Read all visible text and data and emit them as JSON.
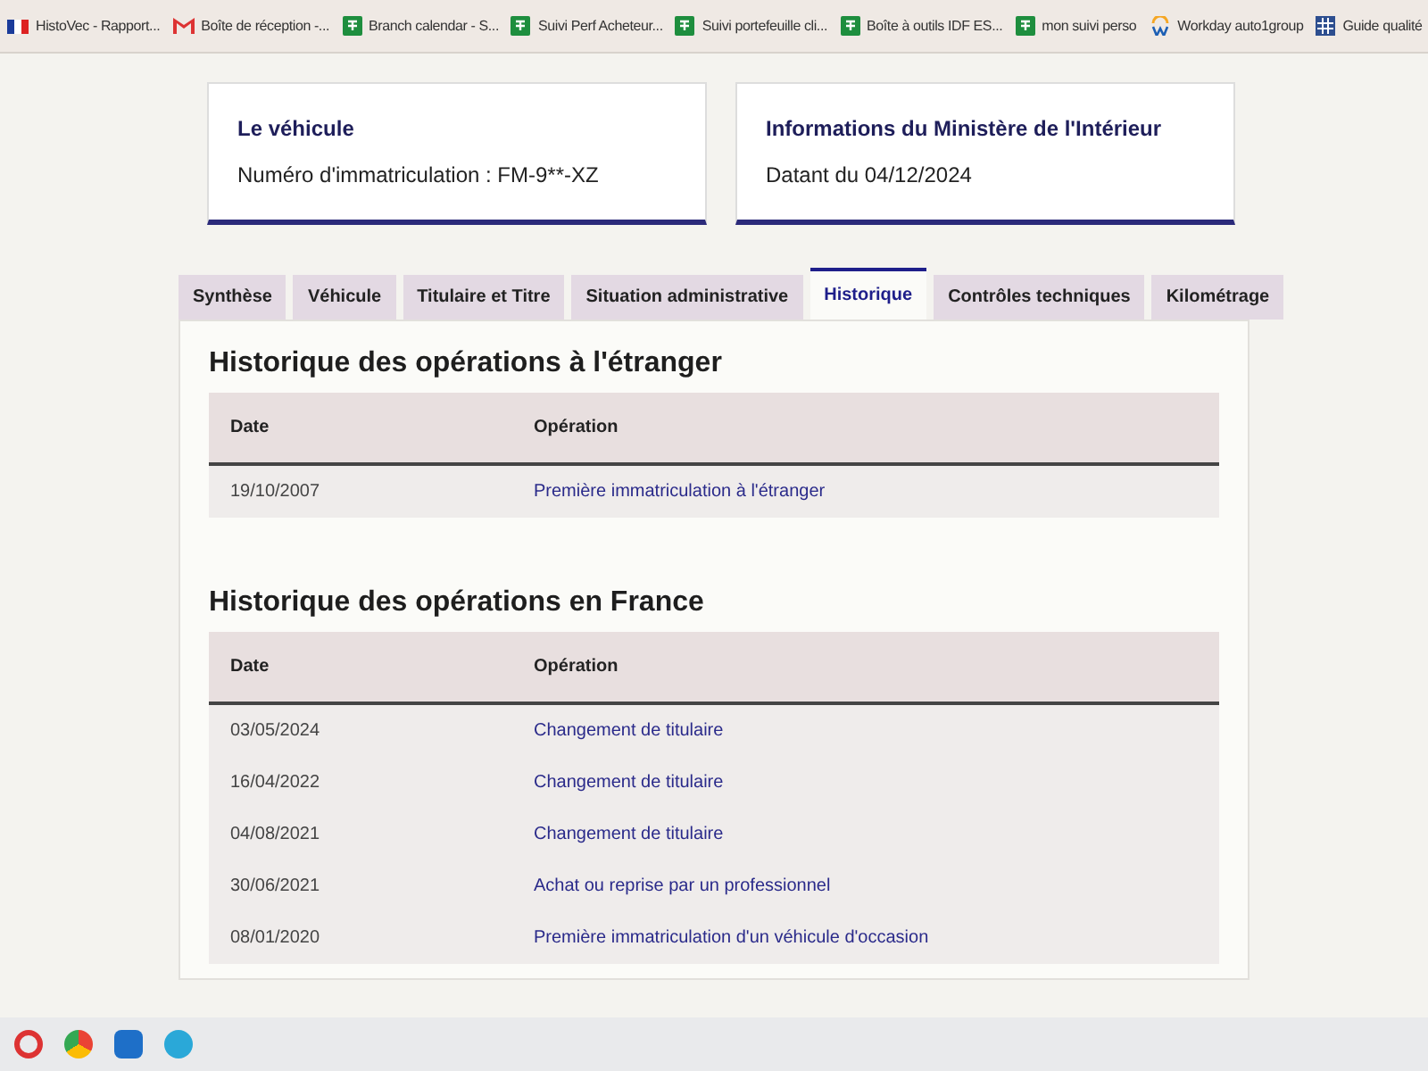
{
  "bookmarks": [
    {
      "label": "HistoVec - Rapport...",
      "kind": "flag"
    },
    {
      "label": "Boîte de réception -...",
      "kind": "mail"
    },
    {
      "label": "Branch calendar - S...",
      "kind": "sheet"
    },
    {
      "label": "Suivi Perf Acheteur...",
      "kind": "sheet"
    },
    {
      "label": "Suivi portefeuille cli...",
      "kind": "sheet"
    },
    {
      "label": "Boîte à outils IDF ES...",
      "kind": "sheet"
    },
    {
      "label": "mon suivi perso",
      "kind": "sheet"
    },
    {
      "label": "Workday auto1group",
      "kind": "workday"
    },
    {
      "label": "Guide qualité",
      "kind": "grid"
    }
  ],
  "cards": [
    {
      "title": "Le véhicule",
      "text": "Numéro d'immatriculation : FM-9**-XZ"
    },
    {
      "title": "Informations du Ministère de l'Intérieur",
      "text": "Datant du 04/12/2024"
    }
  ],
  "tabs": [
    {
      "label": "Synthèse",
      "selected": false
    },
    {
      "label": "Véhicule",
      "selected": false
    },
    {
      "label": "Titulaire et Titre",
      "selected": false
    },
    {
      "label": "Situation administrative",
      "selected": false
    },
    {
      "label": "Historique",
      "selected": true
    },
    {
      "label": "Contrôles techniques",
      "selected": false
    },
    {
      "label": "Kilométrage",
      "selected": false
    }
  ],
  "sections": [
    {
      "title": "Historique des opérations à l'étranger",
      "columns": [
        "Date",
        "Opération"
      ],
      "rows": [
        [
          "19/10/2007",
          "Première immatriculation à l'étranger"
        ]
      ]
    },
    {
      "title": "Historique des opérations en France",
      "columns": [
        "Date",
        "Opération"
      ],
      "rows": [
        [
          "03/05/2024",
          "Changement de titulaire"
        ],
        [
          "16/04/2022",
          "Changement de titulaire"
        ],
        [
          "04/08/2021",
          "Changement de titulaire"
        ],
        [
          "30/06/2021",
          "Achat ou reprise par un professionnel"
        ],
        [
          "08/01/2020",
          "Première immatriculation d'un véhicule d'occasion"
        ]
      ]
    }
  ]
}
